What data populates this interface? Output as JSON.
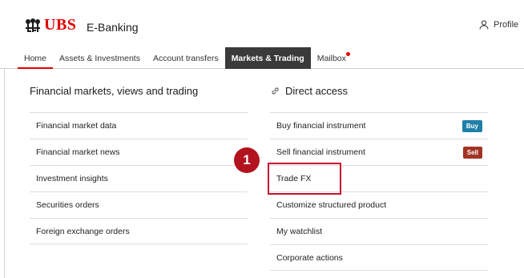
{
  "header": {
    "logo_text": "UBS",
    "app_name": "E-Banking",
    "profile_label": "Profile"
  },
  "nav": {
    "items": [
      {
        "label": "Home"
      },
      {
        "label": "Assets & Investments"
      },
      {
        "label": "Account transfers"
      },
      {
        "label": "Markets & Trading"
      },
      {
        "label": "Mailbox"
      }
    ],
    "active": "Markets & Trading"
  },
  "left_column": {
    "title": "Financial markets, views and trading",
    "items": [
      {
        "label": "Financial market data"
      },
      {
        "label": "Financial market news"
      },
      {
        "label": "Investment insights"
      },
      {
        "label": "Securities orders"
      },
      {
        "label": "Foreign exchange orders"
      }
    ]
  },
  "right_column": {
    "title": "Direct access",
    "items": [
      {
        "label": "Buy financial instrument",
        "badge": "Buy"
      },
      {
        "label": "Sell financial instrument",
        "badge": "Sell"
      },
      {
        "label": "Trade FX"
      },
      {
        "label": "Customize structured product"
      },
      {
        "label": "My watchlist"
      },
      {
        "label": "Corporate actions"
      }
    ]
  },
  "annotation": {
    "step": "1"
  },
  "colors": {
    "brand_red": "#e60000",
    "nav_active_bg": "#3a3a3a",
    "buy_badge": "#1f7fa8",
    "sell_badge": "#a23425",
    "highlight": "#c8102e"
  },
  "icons": {
    "logo": "ubs-keys-icon",
    "profile": "person-icon",
    "direct_access": "link-icon",
    "mailbox_dot": "notification-dot"
  }
}
